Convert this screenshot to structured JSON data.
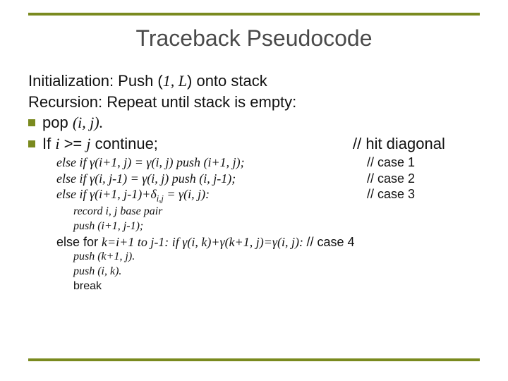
{
  "title": "Traceback Pseudocode",
  "l1a": "Initialization: Push (",
  "l1b": "1, L",
  "l1c": ") onto stack",
  "l2": "Recursion: Repeat until stack is empty:",
  "b1a": "pop ",
  "b1b": "(i, j).",
  "b2a": "If ",
  "b2b": "i",
  "b2c": " >= ",
  "b2d": "j",
  "b2e": " continue;",
  "b2cmt": "// hit diagonal",
  "s1": "else if γ(i+1, j) = γ(i, j) push (i+1, j);",
  "s1cmt": "// case 1",
  "s2": "else if γ(i, j-1) = γ(i, j) push (i, j-1);",
  "s2cmt": "// case 2",
  "s3a": "else if γ(i+1, j-1)+δ",
  "s3sub": "i,j",
  "s3b": " = γ(i, j):",
  "s3cmt": "// case 3",
  "r1": "record i, j base pair",
  "r2": "push (i+1, j-1);",
  "s4a": "else for ",
  "s4b": "k=i+1 to j-1: if γ(i, k)+γ(k+1, j)=γ(i, j): ",
  "s4cmt": "// case 4",
  "p1": "push (k+1, j).",
  "p2": "push (i, k).",
  "p3": "break"
}
